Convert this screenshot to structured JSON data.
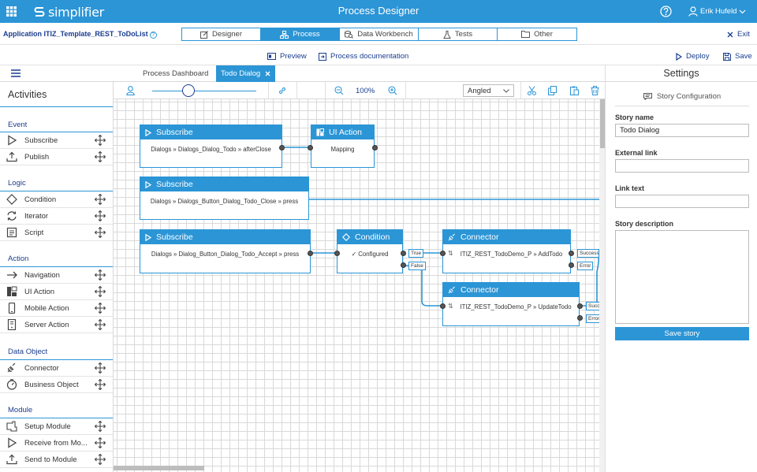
{
  "topbar": {
    "brand": "simplifier",
    "title": "Process Designer",
    "user": "Erik Hufeld"
  },
  "app": {
    "name": "Application ITIZ_Template_REST_ToDoList"
  },
  "main_tabs": [
    {
      "label": "Designer",
      "icon": "edit-icon"
    },
    {
      "label": "Process",
      "icon": "process-icon",
      "active": true
    },
    {
      "label": "Data Workbench",
      "icon": "database-search-icon"
    },
    {
      "label": "Tests",
      "icon": "flask-icon"
    },
    {
      "label": "Other",
      "icon": "folder-icon"
    }
  ],
  "exit_label": "Exit",
  "actions": {
    "preview": "Preview",
    "documentation": "Process documentation",
    "deploy": "Deploy",
    "save": "Save"
  },
  "doc_tabs": {
    "dashboard": "Process Dashboard",
    "active": "Todo Dialog"
  },
  "settings_title": "Settings",
  "sidebar": {
    "title": "Activities",
    "sections": [
      {
        "label": "Event",
        "items": [
          "Subscribe",
          "Publish"
        ]
      },
      {
        "label": "Logic",
        "items": [
          "Condition",
          "Iterator",
          "Script"
        ]
      },
      {
        "label": "Action",
        "items": [
          "Navigation",
          "UI Action",
          "Mobile Action",
          "Server Action"
        ]
      },
      {
        "label": "Data Object",
        "items": [
          "Connector",
          "Business Object"
        ]
      },
      {
        "label": "Module",
        "items": [
          "Setup Module",
          "Receive from Mo...",
          "Send to Module"
        ]
      }
    ]
  },
  "toolbar": {
    "zoom": "100%",
    "line_style": "Angled"
  },
  "nodes": [
    {
      "title": "Subscribe",
      "body": "Dialogs » Dialogs_Dialog_Todo » afterClose"
    },
    {
      "title": "UI Action",
      "body": "Mapping"
    },
    {
      "title": "Subscribe",
      "body": "Dialogs » Dialogs_Button_Dialog_Todo_Close » press"
    },
    {
      "title": "Subscribe",
      "body": "Dialogs » Dialog_Button_Dialog_Todo_Accept » press"
    },
    {
      "title": "Condition",
      "body": "✓ Configured",
      "outputs": [
        "True",
        "False"
      ]
    },
    {
      "title": "Connector",
      "body": "ITIZ_REST_TodoDemo_P » AddTodo",
      "outputs": [
        "Success",
        "Error"
      ]
    },
    {
      "title": "Connector",
      "body": "ITIZ_REST_TodoDemo_P » UpdateTodo",
      "outputs": [
        "Success",
        "Error"
      ]
    }
  ],
  "settings": {
    "config_label": "Story Configuration",
    "story_name_label": "Story name",
    "story_name": "Todo Dialog",
    "external_link_label": "External link",
    "external_link": "",
    "link_text_label": "Link text",
    "link_text": "",
    "description_label": "Story description",
    "description": "",
    "save_label": "Save story"
  },
  "colors": {
    "accent": "#2b95d6",
    "dark_text": "#1a3d8f"
  }
}
